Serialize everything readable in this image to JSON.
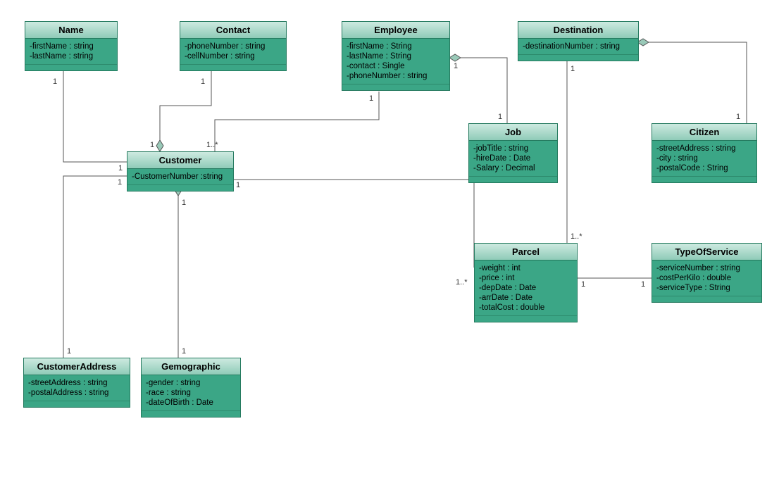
{
  "classes": {
    "name": {
      "title": "Name",
      "attrs": [
        "-firstName : string",
        "-lastName : string"
      ]
    },
    "contact": {
      "title": "Contact",
      "attrs": [
        "-phoneNumber : string",
        "-cellNumber : string"
      ]
    },
    "employee": {
      "title": "Employee",
      "attrs": [
        "-firstName : String",
        "-lastName : String",
        "-contact : Single",
        "-phoneNumber : string"
      ]
    },
    "destination": {
      "title": "Destination",
      "attrs": [
        "-destinationNumber : string"
      ]
    },
    "job": {
      "title": "Job",
      "attrs": [
        "-jobTitle : string",
        "-hireDate : Date",
        "-Salary : Decimal"
      ]
    },
    "citizen": {
      "title": "Citizen",
      "attrs": [
        "-streetAddress : string",
        "-city : string",
        "-postalCode : String"
      ]
    },
    "customer": {
      "title": "Customer",
      "attrs": [
        "-CustomerNumber :string"
      ]
    },
    "parcel": {
      "title": "Parcel",
      "attrs": [
        "-weight : int",
        "-price : int",
        "-depDate : Date",
        "-arrDate : Date",
        "-totalCost : double"
      ]
    },
    "typeofservice": {
      "title": "TypeOfService",
      "attrs": [
        "-serviceNumber : string",
        "-costPerKilo : double",
        "-serviceType : String"
      ]
    },
    "customeraddress": {
      "title": "CustomerAddress",
      "attrs": [
        "-streetAddress : string",
        "-postalAddress : string"
      ]
    },
    "gemographic": {
      "title": "Gemographic",
      "attrs": [
        "-gender : string",
        "-race : string",
        "-dateOfBirth : Date"
      ]
    }
  },
  "mult": {
    "name_1": "1",
    "contact_1": "1",
    "employee_1": "1",
    "employee_1b": "1",
    "dest_1": "1",
    "job_1": "1",
    "citizen_1": "1",
    "cust_name": "1",
    "cust_contact": "1",
    "cust_emp": "1..*",
    "cust_parcel": "1",
    "cust_addr": "1",
    "cust_gem": "1",
    "addr_1": "1",
    "gem_1": "1",
    "parcel_cust": "1..*",
    "parcel_dest": "1..*",
    "parcel_tos": "1",
    "tos_parcel": "1"
  },
  "chart_data": {
    "type": "uml_class_diagram",
    "classes": [
      {
        "name": "Name",
        "attributes": [
          "firstName:string",
          "lastName:string"
        ]
      },
      {
        "name": "Contact",
        "attributes": [
          "phoneNumber:string",
          "cellNumber:string"
        ]
      },
      {
        "name": "Employee",
        "attributes": [
          "firstName:String",
          "lastName:String",
          "contact:Single",
          "phoneNumber:string"
        ]
      },
      {
        "name": "Destination",
        "attributes": [
          "destinationNumber:string"
        ]
      },
      {
        "name": "Job",
        "attributes": [
          "jobTitle:string",
          "hireDate:Date",
          "Salary:Decimal"
        ]
      },
      {
        "name": "Citizen",
        "attributes": [
          "streetAddress:string",
          "city:string",
          "postalCode:String"
        ]
      },
      {
        "name": "Customer",
        "attributes": [
          "CustomerNumber:string"
        ]
      },
      {
        "name": "Parcel",
        "attributes": [
          "weight:int",
          "price:int",
          "depDate:Date",
          "arrDate:Date",
          "totalCost:double"
        ]
      },
      {
        "name": "TypeOfService",
        "attributes": [
          "serviceNumber:string",
          "costPerKilo:double",
          "serviceType:String"
        ]
      },
      {
        "name": "CustomerAddress",
        "attributes": [
          "streetAddress:string",
          "postalAddress:string"
        ]
      },
      {
        "name": "Gemographic",
        "attributes": [
          "gender:string",
          "race:string",
          "dateOfBirth:Date"
        ]
      }
    ],
    "relationships": [
      {
        "from": "Name",
        "to": "Customer",
        "type": "aggregation",
        "ownerEnd": "Customer",
        "mult": {
          "Name": "1",
          "Customer": "1"
        }
      },
      {
        "from": "Contact",
        "to": "Customer",
        "type": "aggregation",
        "ownerEnd": "Customer",
        "mult": {
          "Contact": "1",
          "Customer": "1"
        }
      },
      {
        "from": "Employee",
        "to": "Customer",
        "type": "association",
        "mult": {
          "Employee": "1",
          "Customer": "1..*"
        }
      },
      {
        "from": "Employee",
        "to": "Job",
        "type": "aggregation",
        "ownerEnd": "Employee",
        "mult": {
          "Employee": "1",
          "Job": "1"
        }
      },
      {
        "from": "Destination",
        "to": "Citizen",
        "type": "aggregation",
        "ownerEnd": "Destination",
        "mult": {
          "Destination": "1",
          "Citizen": "1"
        }
      },
      {
        "from": "Destination",
        "to": "Parcel",
        "type": "aggregation",
        "ownerEnd": "Destination",
        "mult": {
          "Destination": "1",
          "Parcel": "1..*"
        }
      },
      {
        "from": "Customer",
        "to": "CustomerAddress",
        "type": "aggregation",
        "ownerEnd": "Customer",
        "mult": {
          "Customer": "1",
          "CustomerAddress": "1"
        }
      },
      {
        "from": "Customer",
        "to": "Gemographic",
        "type": "aggregation",
        "ownerEnd": "Customer",
        "mult": {
          "Customer": "1",
          "Gemographic": "1"
        }
      },
      {
        "from": "Customer",
        "to": "Parcel",
        "type": "association",
        "mult": {
          "Customer": "1",
          "Parcel": "1..*"
        }
      },
      {
        "from": "Parcel",
        "to": "TypeOfService",
        "type": "association",
        "mult": {
          "Parcel": "1",
          "TypeOfService": "1"
        }
      }
    ]
  }
}
